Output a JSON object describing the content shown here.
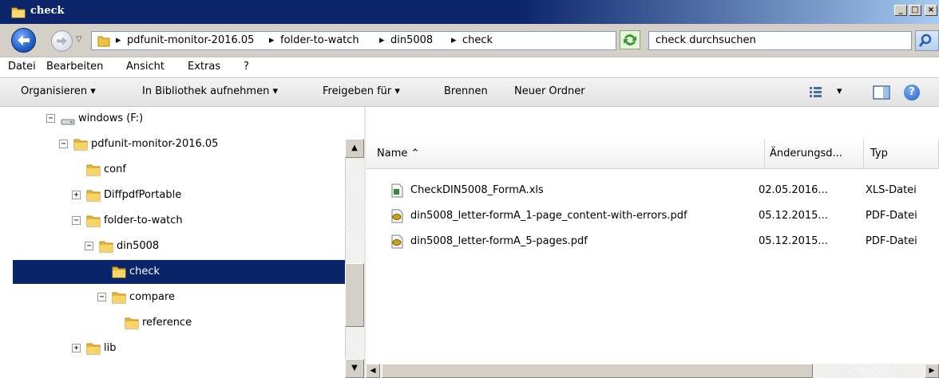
{
  "window": {
    "title": "check",
    "btn_minimize": "_",
    "btn_maximize": "□",
    "btn_close": "×"
  },
  "address": {
    "crumbs": [
      "pdfunit-monitor-2016.05",
      "folder-to-watch",
      "din5008",
      "check"
    ],
    "separator": "▸",
    "search_placeholder": "check durchsuchen"
  },
  "menu": {
    "items": [
      "Datei",
      "Bearbeiten",
      "Ansicht",
      "Extras",
      "?"
    ]
  },
  "commands": {
    "organize": "Organisieren ▾",
    "library": "In Bibliothek aufnehmen ▾",
    "share": "Freigeben für ▾",
    "burn": "Brennen",
    "new_folder": "Neuer Ordner",
    "view_toggle": "▾",
    "help": "?"
  },
  "tree": {
    "items": [
      {
        "label": "windows (F:)",
        "expander": "−",
        "selected": false
      },
      {
        "label": "pdfunit-monitor-2016.05",
        "expander": "−",
        "selected": false
      },
      {
        "label": "conf",
        "expander": "",
        "selected": false
      },
      {
        "label": "DiffpdfPortable",
        "expander": "+",
        "selected": false
      },
      {
        "label": "folder-to-watch",
        "expander": "−",
        "selected": false
      },
      {
        "label": "din5008",
        "expander": "−",
        "selected": false
      },
      {
        "label": "check",
        "expander": "",
        "selected": true
      },
      {
        "label": "compare",
        "expander": "−",
        "selected": false
      },
      {
        "label": "reference",
        "expander": "",
        "selected": false
      },
      {
        "label": "lib",
        "expander": "+",
        "selected": false
      }
    ]
  },
  "list": {
    "columns": [
      "Name ⌃",
      "Änderungsd...",
      "Typ"
    ],
    "files": [
      {
        "name": "CheckDIN5008_FormA.xls",
        "date": "02.05.2016...",
        "type": "XLS-Datei",
        "kind": "xls"
      },
      {
        "name": "din5008_letter-formA_1-page_content-with-errors.pdf",
        "date": "05.12.2015...",
        "type": "PDF-Datei",
        "kind": "pdf"
      },
      {
        "name": "din5008_letter-formA_5-pages.pdf",
        "date": "05.12.2015...",
        "type": "PDF-Datei",
        "kind": "pdf"
      }
    ]
  },
  "scroll": {
    "up": "▲",
    "down": "▼",
    "left": "◀",
    "right": "▶"
  },
  "colors": {
    "title_bar": "#0b246a",
    "selection": "#0a246a",
    "folder": "#f0c040"
  }
}
